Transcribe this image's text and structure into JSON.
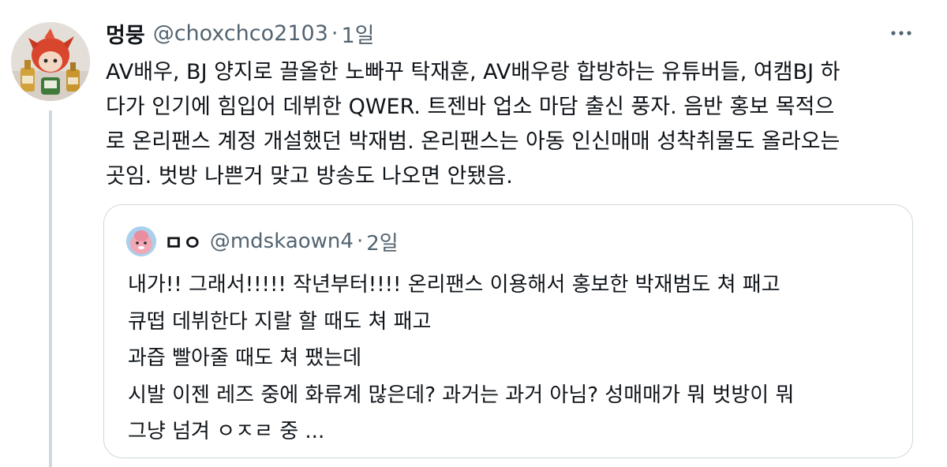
{
  "tweet": {
    "display_name": "멍뭉",
    "handle": "@choxchco2103",
    "separator": "·",
    "time": "1일",
    "more_icon": "more-horizontal-icon",
    "body": "AV배우, BJ 양지로 끌올한 노빠꾸 탁재훈, AV배우랑 합방하는 유튜버들, 여캠BJ 하\n다가 인기에 힘입어 데뷔한 QWER. 트젠바 업소 마담 출신 풍자. 음반 홍보 목적으\n로 온리팬스 계정 개설했던 박재범. 온리팬스는 아동 인신매매 성착취물도 올라오는\n곳임. 벗방 나쁜거 맞고 방송도 나오면 안됐음."
  },
  "quote": {
    "display_name": "ㅁㅇ",
    "handle": "@mdskaown4",
    "separator": "·",
    "time": "2일",
    "body": "내가!! 그래서!!!!! 작년부터!!!! 온리팬스 이용해서 홍보한 박재범도 쳐 패고\n큐떱 데뷔한다 지랄 할 때도 쳐 패고\n과즙 빨아줄 때도 쳐 팼는데\n시발 이젠 레즈 중에 화류계 많은데? 과거는 과거 아님? 성매매가 뭐 벗방이 뭐\n그냥 넘겨 ㅇㅈㄹ 중 ..."
  },
  "colors": {
    "text_primary": "#0f1419",
    "text_secondary": "#536471",
    "border": "#cfd9de"
  }
}
